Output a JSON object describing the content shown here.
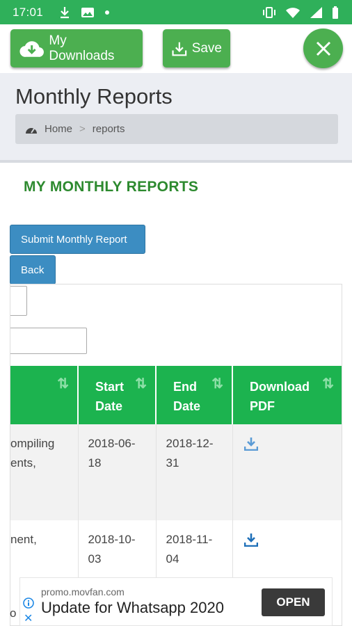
{
  "status_bar": {
    "time": "17:01"
  },
  "toolbar": {
    "downloads_label": "My Downloads",
    "save_label": "Save"
  },
  "header": {
    "title": "Monthly Reports",
    "breadcrumb": [
      "Home",
      ">",
      "reports"
    ]
  },
  "section": {
    "title": "MY MONTHLY REPORTS"
  },
  "buttons": {
    "submit_label": "Submit Monthly Report",
    "back_label": "Back"
  },
  "table": {
    "columns": [
      "",
      "Start\nDate",
      "End\nDate",
      "Download\nPDF"
    ],
    "rows": [
      {
        "title_lines": [
          "ompiling",
          "ents,"
        ],
        "start": [
          "2018-06-",
          "18"
        ],
        "end": [
          "2018-12-",
          "31"
        ]
      },
      {
        "title_lines": [
          "nent,"
        ],
        "start": [
          "2018-10-",
          "03"
        ],
        "end": [
          "2018-11-",
          "04"
        ]
      }
    ],
    "bottom_cut_text": "o"
  },
  "ad": {
    "domain": "promo.movfan.com",
    "headline": "Update for Whatsapp 2020",
    "cta": "OPEN"
  },
  "colors": {
    "primary_green": "#4caf50",
    "table_header_green": "#1cb34f",
    "blue_button": "#3c8dc2",
    "title_green": "#2d8a2f"
  }
}
